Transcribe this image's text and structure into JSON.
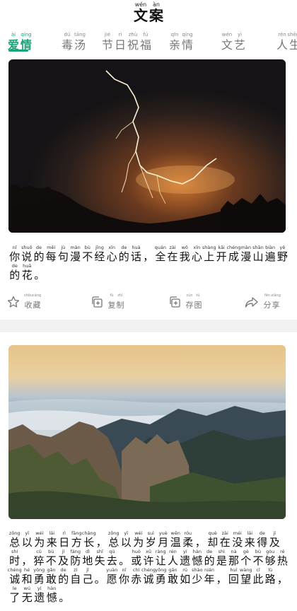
{
  "header": {
    "logo": [
      {
        "py": "wén",
        "hz": "文"
      },
      {
        "py": "àn",
        "hz": "案"
      }
    ]
  },
  "tabs": [
    {
      "chars": [
        {
          "py": "ài",
          "hz": "爱"
        },
        {
          "py": "qíng",
          "hz": "情"
        }
      ],
      "active": true
    },
    {
      "chars": [
        {
          "py": "dú",
          "hz": "毒"
        },
        {
          "py": "tāng",
          "hz": "汤"
        }
      ],
      "active": false
    },
    {
      "chars": [
        {
          "py": "jié",
          "hz": "节"
        },
        {
          "py": "rì",
          "hz": "日"
        },
        {
          "py": "zhù",
          "hz": "祝"
        },
        {
          "py": "fú",
          "hz": "福"
        }
      ],
      "active": false
    },
    {
      "chars": [
        {
          "py": "qīn",
          "hz": "亲"
        },
        {
          "py": "qíng",
          "hz": "情"
        }
      ],
      "active": false
    },
    {
      "chars": [
        {
          "py": "wén",
          "hz": "文"
        },
        {
          "py": "yì",
          "hz": "艺"
        }
      ],
      "active": false
    },
    {
      "chars": [
        {
          "py": "rén",
          "hz": "人"
        },
        {
          "py": "shēng",
          "hz": "生"
        }
      ],
      "active": false
    }
  ],
  "posts": [
    {
      "lines": [
        [
          {
            "py": "nǐ",
            "hz": "你"
          },
          {
            "py": "shuō",
            "hz": "说"
          },
          {
            "py": "de",
            "hz": "的"
          },
          {
            "py": "měi",
            "hz": "每"
          },
          {
            "py": "jù",
            "hz": "句"
          },
          {
            "py": "màn",
            "hz": "漫"
          },
          {
            "py": "bù",
            "hz": "不"
          },
          {
            "py": "jīng",
            "hz": "经"
          },
          {
            "py": "xīn",
            "hz": "心"
          },
          {
            "py": "de",
            "hz": "的"
          },
          {
            "py": "huà",
            "hz": "话"
          },
          {
            "py": "",
            "hz": "，"
          },
          {
            "py": "quán",
            "hz": "全"
          },
          {
            "py": "zài",
            "hz": "在"
          },
          {
            "py": "wǒ",
            "hz": "我"
          },
          {
            "py": "xīn",
            "hz": "心"
          },
          {
            "py": "shàng",
            "hz": "上"
          },
          {
            "py": "kāi",
            "hz": "开"
          },
          {
            "py": "chéng",
            "hz": "成"
          },
          {
            "py": "màn",
            "hz": "漫"
          },
          {
            "py": "shān",
            "hz": "山"
          },
          {
            "py": "biàn",
            "hz": "遍"
          },
          {
            "py": "yě",
            "hz": "野"
          }
        ],
        [
          {
            "py": "de",
            "hz": "的"
          },
          {
            "py": "huā",
            "hz": "花"
          },
          {
            "py": "",
            "hz": "。"
          }
        ]
      ]
    },
    {
      "lines": [
        [
          {
            "py": "zǒng",
            "hz": "总"
          },
          {
            "py": "yǐ",
            "hz": "以"
          },
          {
            "py": "wéi",
            "hz": "为"
          },
          {
            "py": "lái",
            "hz": "来"
          },
          {
            "py": "rì",
            "hz": "日"
          },
          {
            "py": "fāng",
            "hz": "方"
          },
          {
            "py": "cháng",
            "hz": "长"
          },
          {
            "py": "",
            "hz": "，"
          },
          {
            "py": "zǒng",
            "hz": "总"
          },
          {
            "py": "yǐ",
            "hz": "以"
          },
          {
            "py": "wéi",
            "hz": "为"
          },
          {
            "py": "suì",
            "hz": "岁"
          },
          {
            "py": "yuè",
            "hz": "月"
          },
          {
            "py": "wēn",
            "hz": "温"
          },
          {
            "py": "róu",
            "hz": "柔"
          },
          {
            "py": "",
            "hz": "，"
          },
          {
            "py": "què",
            "hz": "却"
          },
          {
            "py": "zài",
            "hz": "在"
          },
          {
            "py": "méi",
            "hz": "没"
          },
          {
            "py": "lái",
            "hz": "来"
          },
          {
            "py": "de",
            "hz": "得"
          },
          {
            "py": "jí",
            "hz": "及"
          }
        ],
        [
          {
            "py": "shí",
            "hz": "时"
          },
          {
            "py": "",
            "hz": "，"
          },
          {
            "py": "cù",
            "hz": "猝"
          },
          {
            "py": "bù",
            "hz": "不"
          },
          {
            "py": "jí",
            "hz": "及"
          },
          {
            "py": "fáng",
            "hz": "防"
          },
          {
            "py": "dì",
            "hz": "地"
          },
          {
            "py": "shī",
            "hz": "失"
          },
          {
            "py": "qù",
            "hz": "去"
          },
          {
            "py": "",
            "hz": "。"
          },
          {
            "py": "huò",
            "hz": "或"
          },
          {
            "py": "xǔ",
            "hz": "许"
          },
          {
            "py": "ràng",
            "hz": "让"
          },
          {
            "py": "rén",
            "hz": "人"
          },
          {
            "py": "yí",
            "hz": "遗"
          },
          {
            "py": "hàn",
            "hz": "憾"
          },
          {
            "py": "de",
            "hz": "的"
          },
          {
            "py": "shì",
            "hz": "是"
          },
          {
            "py": "nà",
            "hz": "那"
          },
          {
            "py": "gè",
            "hz": "个"
          },
          {
            "py": "bù",
            "hz": "不"
          },
          {
            "py": "gòu",
            "hz": "够"
          },
          {
            "py": "rè",
            "hz": "热"
          }
        ],
        [
          {
            "py": "chéng",
            "hz": "诚"
          },
          {
            "py": "hé",
            "hz": "和"
          },
          {
            "py": "yǒng",
            "hz": "勇"
          },
          {
            "py": "gǎn",
            "hz": "敢"
          },
          {
            "py": "de",
            "hz": "的"
          },
          {
            "py": "zì",
            "hz": "自"
          },
          {
            "py": "jǐ",
            "hz": "己"
          },
          {
            "py": "",
            "hz": "。"
          },
          {
            "py": "yuàn",
            "hz": "愿"
          },
          {
            "py": "nǐ",
            "hz": "你"
          },
          {
            "py": "chì",
            "hz": "赤"
          },
          {
            "py": "chéng",
            "hz": "诚"
          },
          {
            "py": "yǒng",
            "hz": "勇"
          },
          {
            "py": "gǎn",
            "hz": "敢"
          },
          {
            "py": "rú",
            "hz": "如"
          },
          {
            "py": "shào",
            "hz": "少"
          },
          {
            "py": "nián",
            "hz": "年"
          },
          {
            "py": "",
            "hz": "，"
          },
          {
            "py": "huí",
            "hz": "回"
          },
          {
            "py": "wàng",
            "hz": "望"
          },
          {
            "py": "cǐ",
            "hz": "此"
          },
          {
            "py": "lù",
            "hz": "路"
          },
          {
            "py": "",
            "hz": "，"
          }
        ],
        [
          {
            "py": "le",
            "hz": "了"
          },
          {
            "py": "wú",
            "hz": "无"
          },
          {
            "py": "yí",
            "hz": "遗"
          },
          {
            "py": "hàn",
            "hz": "憾"
          },
          {
            "py": "",
            "hz": "。"
          }
        ]
      ]
    }
  ],
  "actions": [
    {
      "icon": "star-icon",
      "chars": [
        {
          "py": "shōu",
          "hz": "收"
        },
        {
          "py": "cáng",
          "hz": "藏"
        }
      ]
    },
    {
      "icon": "copy-icon",
      "chars": [
        {
          "py": "fù",
          "hz": "复"
        },
        {
          "py": "zhì",
          "hz": "制"
        }
      ]
    },
    {
      "icon": "save-image-icon",
      "chars": [
        {
          "py": "cún",
          "hz": "存"
        },
        {
          "py": "tú",
          "hz": "图"
        }
      ]
    },
    {
      "icon": "share-icon",
      "chars": [
        {
          "py": "fēn",
          "hz": "分"
        },
        {
          "py": "xiǎng",
          "hz": "享"
        }
      ]
    }
  ],
  "colors": {
    "accent": "#1aa37a",
    "tab_inactive": "#777777",
    "text": "#111111"
  }
}
